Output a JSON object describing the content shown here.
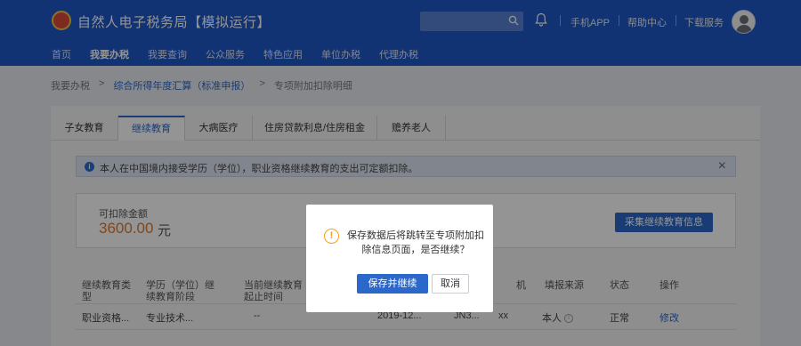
{
  "header": {
    "site_title": "自然人电子税务局【模拟运行】",
    "logo_icon": "tax-emblem-icon",
    "top_links": [
      "手机APP",
      "帮助中心",
      "下载服务"
    ],
    "nav": [
      "首页",
      "我要办税",
      "我要查询",
      "公众服务",
      "特色应用",
      "单位办税",
      "代理办税"
    ],
    "active_nav": "我要办税",
    "brand_color": "#1f59c7"
  },
  "breadcrumb": [
    "我要办税",
    "综合所得年度汇算（标准申报）",
    "专项附加扣除明细"
  ],
  "tabs": [
    "子女教育",
    "继续教育",
    "大病医疗",
    "住房贷款利息/住房租金",
    "赡养老人"
  ],
  "active_tab": "继续教育",
  "notice": {
    "text": "本人在中国境内接受学历（学位），职业资格继续教育的支出可定额扣除。",
    "close": "×"
  },
  "amount": {
    "label": "可扣除金额",
    "value": "3600.00",
    "unit": "元",
    "collect_button": "采集继续教育信息"
  },
  "table": {
    "headers": [
      "继续教育类型",
      "学历（学位）继续教育阶段",
      "当前继续教育起止时间",
      "机",
      "填报来源",
      "状态",
      "操作"
    ],
    "row": {
      "type": "职业资格...",
      "stage": "专业技术...",
      "period": "--",
      "date": "2019-12...",
      "code": "JN3...",
      "org": "xx",
      "source": "本人",
      "status": "正常",
      "action": "修改"
    }
  },
  "modal": {
    "message": "保存数据后将跳转至专项附加扣除信息页面，是否继续？",
    "confirm": "保存并继续",
    "cancel": "取消",
    "icon": "warning-icon"
  }
}
